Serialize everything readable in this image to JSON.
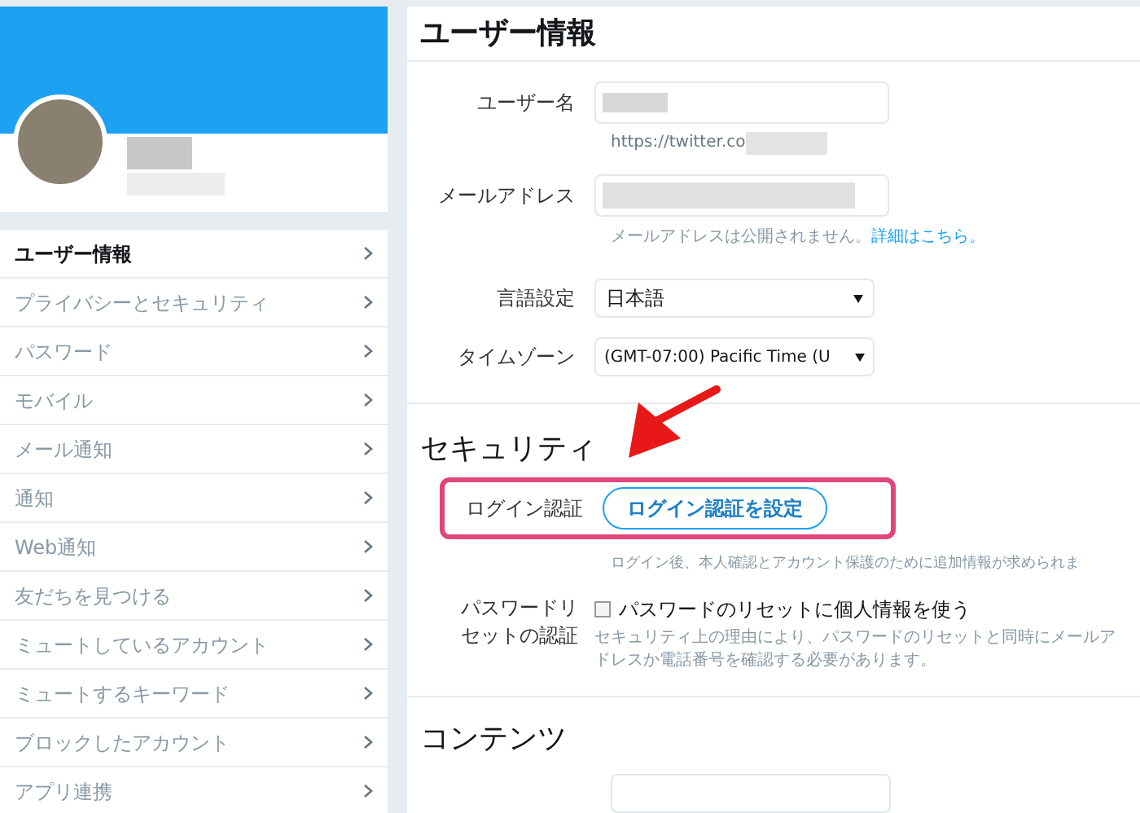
{
  "sidebar": {
    "items": [
      {
        "label": "ユーザー情報",
        "selected": true
      },
      {
        "label": "プライバシーとセキュリティ",
        "selected": false
      },
      {
        "label": "パスワード",
        "selected": false
      },
      {
        "label": "モバイル",
        "selected": false
      },
      {
        "label": "メール通知",
        "selected": false
      },
      {
        "label": "通知",
        "selected": false
      },
      {
        "label": "Web通知",
        "selected": false
      },
      {
        "label": "友だちを見つける",
        "selected": false
      },
      {
        "label": "ミュートしているアカウント",
        "selected": false
      },
      {
        "label": "ミュートするキーワード",
        "selected": false
      },
      {
        "label": "ブロックしたアカウント",
        "selected": false
      },
      {
        "label": "アプリ連携",
        "selected": false
      }
    ]
  },
  "user_info": {
    "title": "ユーザー情報",
    "username": {
      "label": "ユーザー名",
      "url": "https://twitter.co"
    },
    "email": {
      "label": "メールアドレス",
      "note": "メールアドレスは公開されません。",
      "link": "詳細はこちら。"
    },
    "language": {
      "label": "言語設定",
      "value": "日本語"
    },
    "timezone": {
      "label": "タイムゾーン",
      "value": "(GMT-07:00) Pacific Time (U"
    }
  },
  "security": {
    "title": "セキュリティ",
    "login_verification": {
      "label": "ログイン認証",
      "button": "ログイン認証を設定",
      "note": "ログイン後、本人確認とアカウント保護のために追加情報が求められま"
    },
    "password_reset": {
      "label": "パスワードリセットの認証",
      "checkbox": "パスワードのリセットに個人情報を使う",
      "checked": false,
      "note": "セキュリティ上の理由により、パスワードのリセットと同時にメールアドレスか電話番号を確認する必要があります。"
    }
  },
  "content": {
    "title": "コンテンツ"
  }
}
